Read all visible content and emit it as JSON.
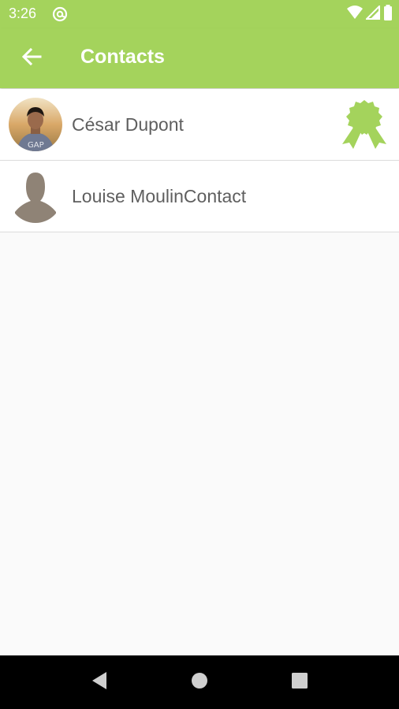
{
  "status_bar": {
    "time": "3:26",
    "icons": [
      "at-sign-icon",
      "wifi-icon",
      "cell-signal-icon",
      "battery-icon"
    ]
  },
  "app_bar": {
    "back_icon": "arrow-left-icon",
    "title": "Contacts"
  },
  "contacts": [
    {
      "name": "César Dupont",
      "avatar": "photo-avatar",
      "badge_icon": "award-ribbon-icon"
    },
    {
      "name": "Louise MoulinContact",
      "avatar": "silhouette-avatar"
    }
  ],
  "nav_bar": {
    "buttons": [
      "back-triangle-icon",
      "home-circle-icon",
      "recents-square-icon"
    ]
  },
  "colors": {
    "accent": "#a4d35c",
    "background": "#fafafa",
    "text": "#5f5f5f",
    "silhouette": "#8f8376"
  }
}
